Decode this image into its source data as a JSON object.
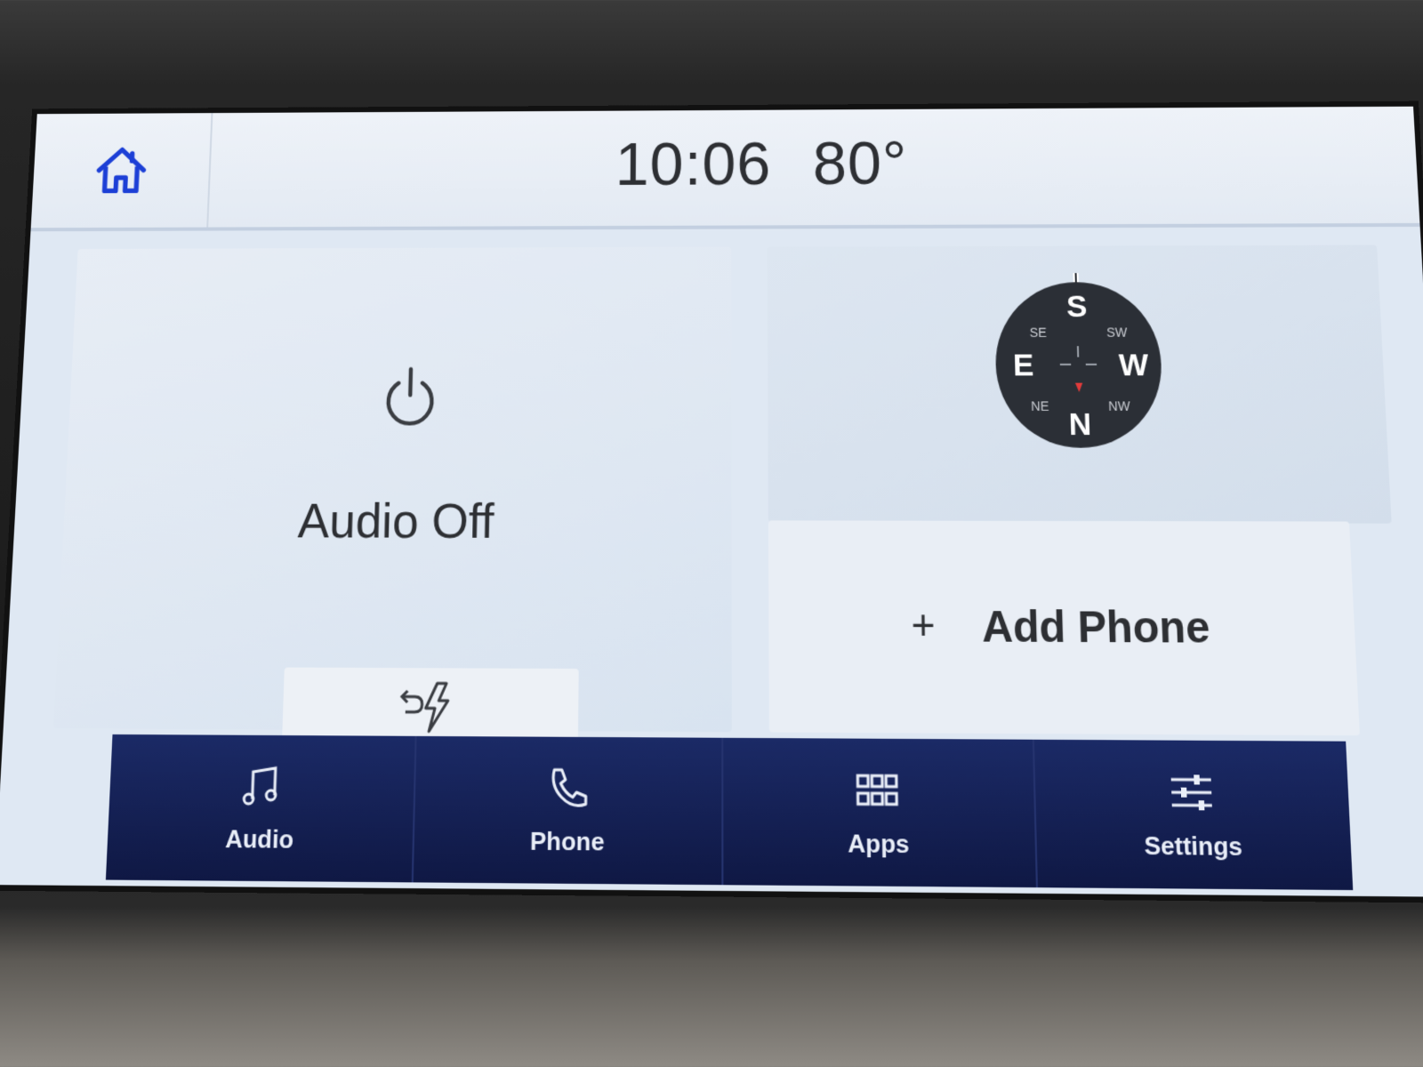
{
  "status": {
    "time": "10:06",
    "temperature": "80°"
  },
  "audio": {
    "status_label": "Audio Off"
  },
  "compass": {
    "heading": "S",
    "labels": [
      "S",
      "SW",
      "W",
      "NW",
      "N",
      "NE",
      "E",
      "SE"
    ]
  },
  "phone": {
    "add_label": "Add Phone",
    "add_icon": "+"
  },
  "nav": {
    "items": [
      {
        "label": "Audio",
        "icon": "music-note-icon"
      },
      {
        "label": "Phone",
        "icon": "phone-icon"
      },
      {
        "label": "Apps",
        "icon": "grid-icon"
      },
      {
        "label": "Settings",
        "icon": "sliders-icon"
      }
    ]
  },
  "colors": {
    "accent_blue": "#1c3fd6",
    "nav_background": "#1b2a66",
    "screen_background": "#dfe8f3"
  }
}
